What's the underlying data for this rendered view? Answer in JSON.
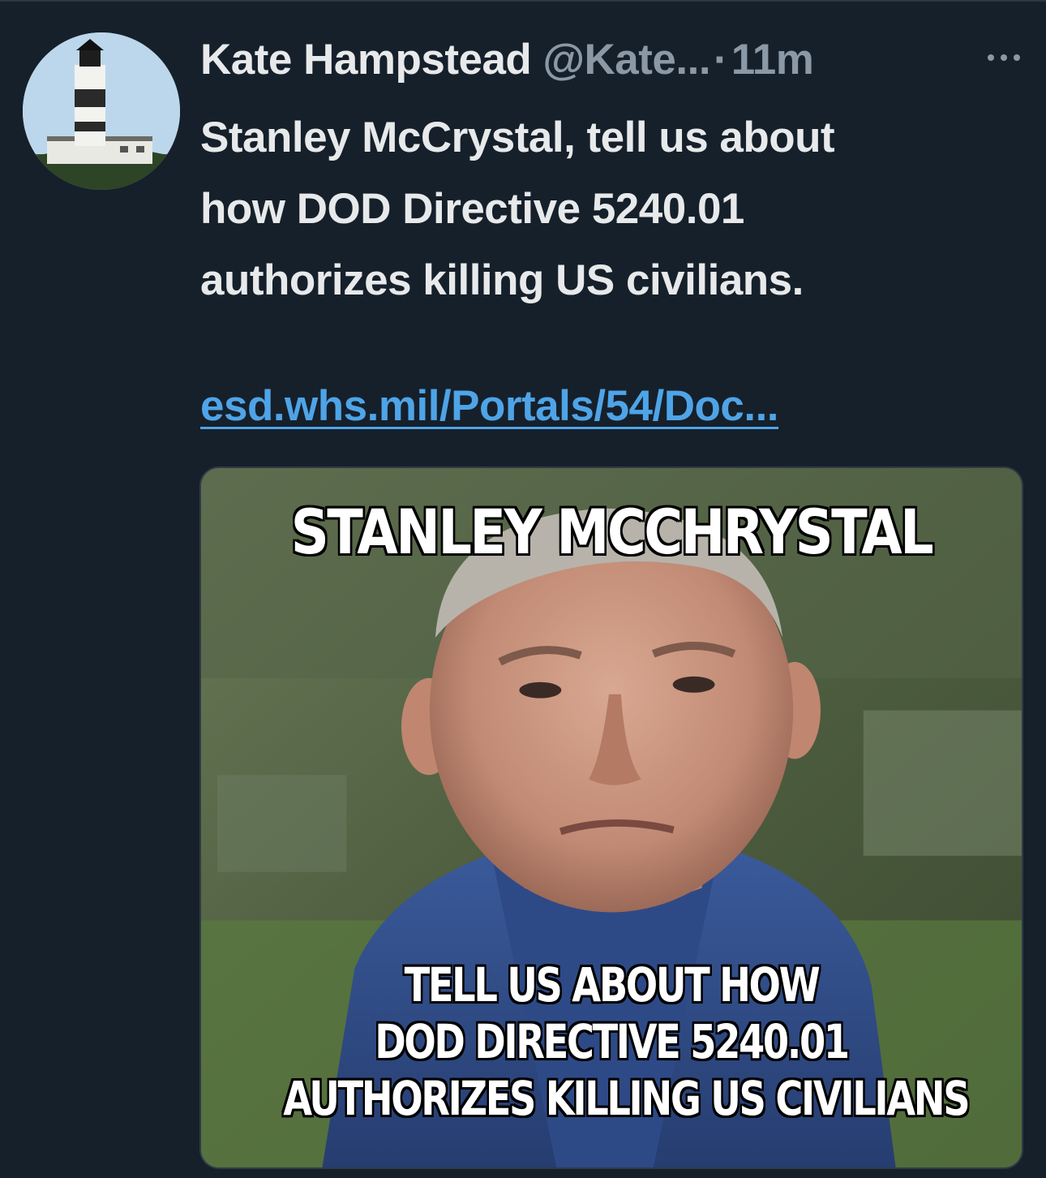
{
  "tweet": {
    "display_name": "Kate Hampstead",
    "handle": "@Kate...",
    "separator": "·",
    "time": "11m",
    "more_icon": "more-horizontal-icon",
    "body_lines": [
      "Stanley McCrystal, tell us about",
      "how DOD Directive 5240.01",
      "authorizes killing US civilians."
    ],
    "link_text": "esd.whs.mil/Portals/54/Doc..."
  },
  "media": {
    "top_caption": "STANLEY MCCHRYSTAL",
    "bottom_caption_lines": [
      "TELL US ABOUT HOW",
      "DOD DIRECTIVE 5240.01",
      "AUTHORIZES KILLING US CIVILIANS"
    ]
  },
  "colors": {
    "background": "#16202b",
    "primary_text": "#e7e9ea",
    "secondary_text": "#8b98a5",
    "link": "#4ea4e7"
  }
}
